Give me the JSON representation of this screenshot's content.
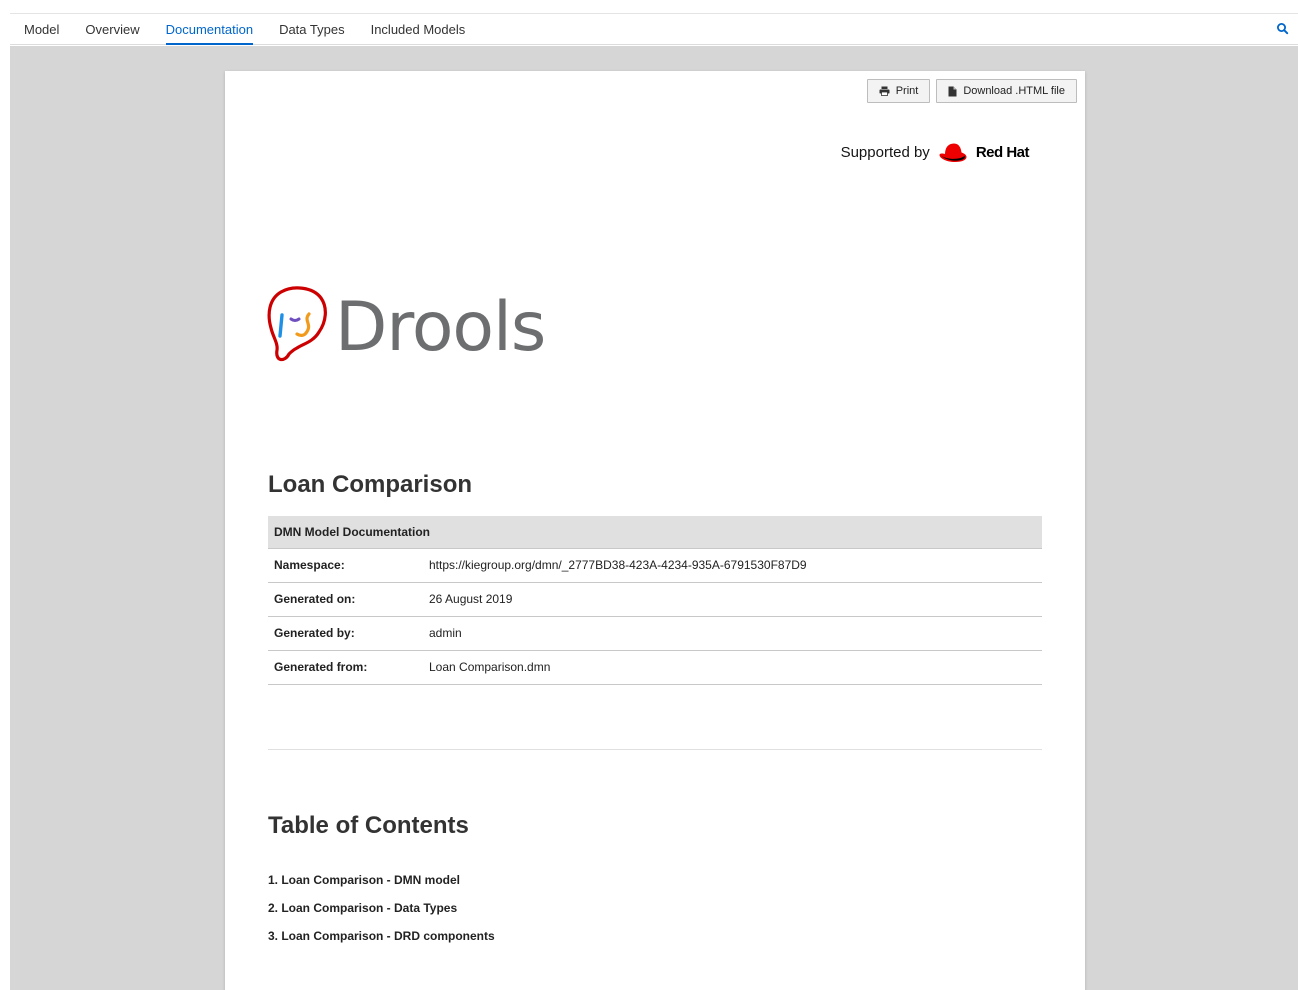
{
  "tabs": [
    {
      "label": "Model"
    },
    {
      "label": "Overview"
    },
    {
      "label": "Documentation",
      "active": true
    },
    {
      "label": "Data Types"
    },
    {
      "label": "Included Models"
    }
  ],
  "search_icon": "search-icon",
  "toolbar": {
    "print_label": "Print",
    "print_icon": "print-icon",
    "download_label": "Download .HTML file",
    "download_icon": "file-icon"
  },
  "supported": {
    "text": "Supported by",
    "brand": "Red Hat",
    "brand_icon": "redhat-fedora-icon"
  },
  "logo": {
    "text": "Drools",
    "icon": "drools-face-icon"
  },
  "model_title": "Loan Comparison",
  "meta_table": {
    "header": "DMN Model Documentation",
    "rows": [
      {
        "key": "Namespace:",
        "value": "https://kiegroup.org/dmn/_2777BD38-423A-4234-935A-6791530F87D9"
      },
      {
        "key": "Generated on:",
        "value": "26 August 2019"
      },
      {
        "key": "Generated by:",
        "value": "admin"
      },
      {
        "key": "Generated from:",
        "value": "Loan Comparison.dmn"
      }
    ]
  },
  "toc": {
    "title": "Table of Contents",
    "items": [
      "1. Loan Comparison - DMN model",
      "2. Loan Comparison - Data Types",
      "3. Loan Comparison - DRD components"
    ]
  },
  "colors": {
    "accent": "#0066cc",
    "brand_red": "#ee0000",
    "workarea_bg": "#d6d6d6"
  }
}
